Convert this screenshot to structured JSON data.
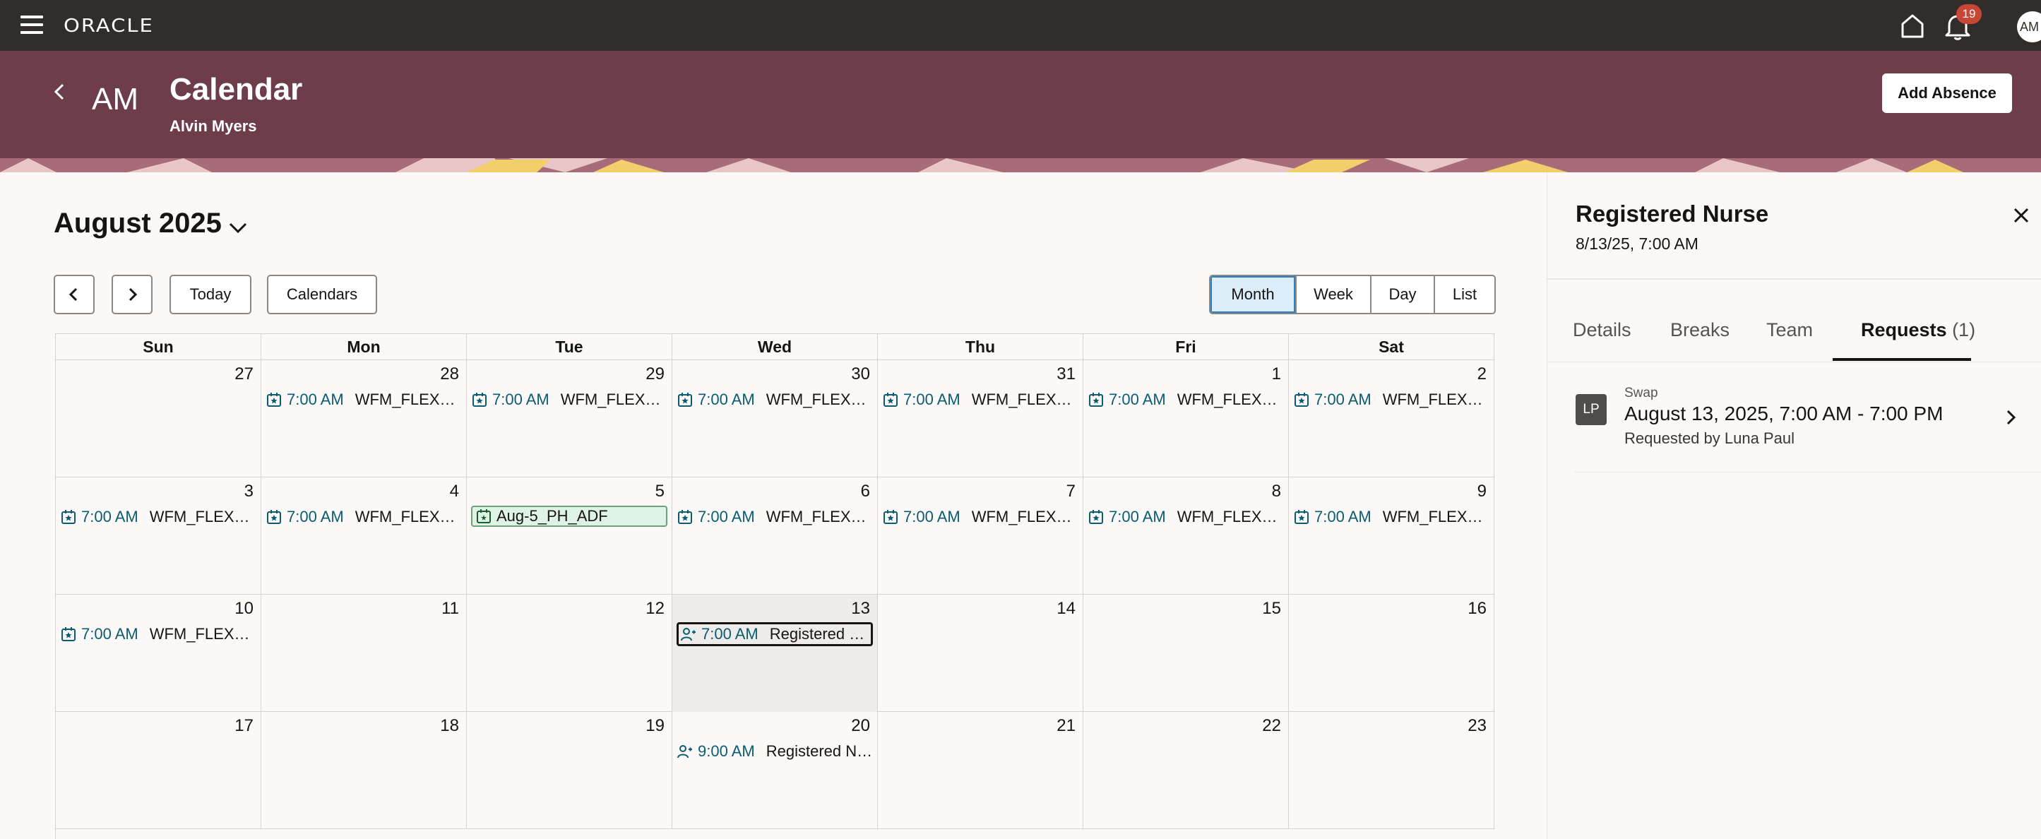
{
  "topbar": {
    "logo": "ORACLE",
    "notification_count": "19",
    "user_initials": "AM"
  },
  "header": {
    "avatar_initials": "AM",
    "title": "Calendar",
    "subtitle": "Alvin Myers",
    "add_absence_label": "Add Absence"
  },
  "calendar": {
    "month_label": "August 2025",
    "today_label": "Today",
    "calendars_label": "Calendars",
    "views": [
      "Month",
      "Week",
      "Day",
      "List"
    ],
    "active_view": "Month",
    "weekdays": [
      "Sun",
      "Mon",
      "Tue",
      "Wed",
      "Thu",
      "Fri",
      "Sat"
    ],
    "weeks": [
      [
        {
          "day": "27",
          "event": null
        },
        {
          "day": "28",
          "event": {
            "time": "7:00 AM",
            "title": "WFM_FLEX_…",
            "kind": "shift"
          }
        },
        {
          "day": "29",
          "event": {
            "time": "7:00 AM",
            "title": "WFM_FLEX_…",
            "kind": "shift"
          }
        },
        {
          "day": "30",
          "event": {
            "time": "7:00 AM",
            "title": "WFM_FLEX_…",
            "kind": "shift"
          }
        },
        {
          "day": "31",
          "event": {
            "time": "7:00 AM",
            "title": "WFM_FLEX_…",
            "kind": "shift"
          }
        },
        {
          "day": "1",
          "event": {
            "time": "7:00 AM",
            "title": "WFM_FLEX_…",
            "kind": "shift"
          }
        },
        {
          "day": "2",
          "event": {
            "time": "7:00 AM",
            "title": "WFM_FLEX_…",
            "kind": "shift"
          }
        }
      ],
      [
        {
          "day": "3",
          "event": {
            "time": "7:00 AM",
            "title": "WFM_FLEX_…",
            "kind": "shift"
          }
        },
        {
          "day": "4",
          "event": {
            "time": "7:00 AM",
            "title": "WFM_FLEX_…",
            "kind": "shift"
          }
        },
        {
          "day": "5",
          "event": {
            "time": "",
            "title": "Aug-5_PH_ADF",
            "kind": "holiday"
          }
        },
        {
          "day": "6",
          "event": {
            "time": "7:00 AM",
            "title": "WFM_FLEX_…",
            "kind": "shift"
          }
        },
        {
          "day": "7",
          "event": {
            "time": "7:00 AM",
            "title": "WFM_FLEX_…",
            "kind": "shift"
          }
        },
        {
          "day": "8",
          "event": {
            "time": "7:00 AM",
            "title": "WFM_FLEX_…",
            "kind": "shift"
          }
        },
        {
          "day": "9",
          "event": {
            "time": "7:00 AM",
            "title": "WFM_FLEX_…",
            "kind": "shift"
          }
        }
      ],
      [
        {
          "day": "10",
          "event": {
            "time": "7:00 AM",
            "title": "WFM_FLEX_…",
            "kind": "shift"
          }
        },
        {
          "day": "11",
          "event": null
        },
        {
          "day": "12",
          "event": null
        },
        {
          "day": "13",
          "selected": true,
          "event": {
            "time": "7:00 AM",
            "title": "Registered N…",
            "kind": "swap",
            "focused": true
          }
        },
        {
          "day": "14",
          "event": null
        },
        {
          "day": "15",
          "event": null
        },
        {
          "day": "16",
          "event": null
        }
      ],
      [
        {
          "day": "17",
          "event": null
        },
        {
          "day": "18",
          "event": null
        },
        {
          "day": "19",
          "event": null
        },
        {
          "day": "20",
          "event": {
            "time": "9:00 AM",
            "title": "Registered N…",
            "kind": "swap"
          }
        },
        {
          "day": "21",
          "event": null
        },
        {
          "day": "22",
          "event": null
        },
        {
          "day": "23",
          "event": null
        }
      ]
    ]
  },
  "panel": {
    "title": "Registered Nurse",
    "subtitle": "8/13/25, 7:00 AM",
    "tabs": [
      "Details",
      "Breaks",
      "Team",
      "Requests"
    ],
    "active_tab": "Requests",
    "requests_count": "(1)",
    "request": {
      "avatar": "LP",
      "type": "Swap",
      "date_range": "August 13, 2025, 7:00 AM - 7:00 PM",
      "requested_by": "Requested by Luna Paul"
    }
  },
  "colors": {
    "topbar": "#312d2a",
    "header": "#6e3d4b",
    "event_time": "#0b5c70",
    "badge": "#c74634",
    "active_view_bg": "#dcecf8"
  }
}
